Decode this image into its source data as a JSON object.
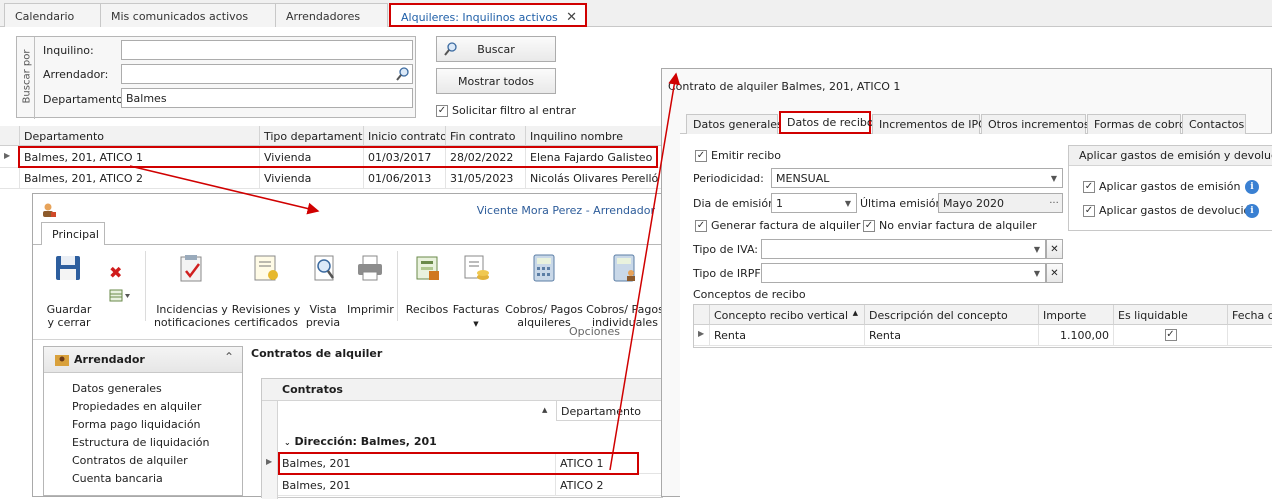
{
  "tabs": [
    {
      "label": "Calendario"
    },
    {
      "label": "Mis comunicados activos"
    },
    {
      "label": "Arrendadores"
    },
    {
      "label": "Alquileres: Inquilinos activos"
    }
  ],
  "filter": {
    "group_label": "Buscar por",
    "inquilino_label": "Inquilino:",
    "inquilino_value": "",
    "arrendador_label": "Arrendador:",
    "arrendador_value": "",
    "departamento_label": "Departamento:",
    "departamento_value": "Balmes",
    "search_button": "Buscar",
    "show_all_button": "Mostrar todos",
    "request_filter_label": "Solicitar filtro al entrar"
  },
  "main_grid": {
    "columns": [
      "Departamento",
      "Tipo departamento",
      "Inicio contrato",
      "Fin contrato",
      "Inquilino nombre"
    ],
    "rows": [
      [
        "Balmes, 201, ATICO 1",
        "Vivienda",
        "01/03/2017",
        "28/02/2022",
        "Elena Fajardo Galisteo"
      ],
      [
        "Balmes, 201, ATICO 2",
        "Vivienda",
        "01/06/2013",
        "31/05/2023",
        "Nicolás Olivares Perelló"
      ]
    ]
  },
  "landlord_window": {
    "title": "Vicente Mora Perez - Arrendador",
    "ribbon_tab": "Principal",
    "buttons": [
      {
        "label": "Guardar\ny cerrar",
        "icon": "save-icon"
      },
      {
        "label": "Incidencias y\nnotificaciones",
        "icon": "incidents-icon"
      },
      {
        "label": "Revisiones y\ncertificados",
        "icon": "certificate-icon"
      },
      {
        "label": "Vista\nprevia",
        "icon": "preview-icon"
      },
      {
        "label": "Imprimir",
        "icon": "print-icon"
      },
      {
        "label": "Recibos",
        "icon": "receipts-icon"
      },
      {
        "label": "Facturas",
        "icon": "invoices-icon"
      },
      {
        "label": "Cobros/ Pagos\nalquileres",
        "icon": "calculator-icon"
      },
      {
        "label": "Cobros/ Pagos\nindividuales",
        "icon": "calculator-person-icon"
      }
    ],
    "group_label": "Opciones",
    "nav_header": "Arrendador",
    "nav_items": [
      "Datos generales",
      "Propiedades en alquiler",
      "Forma pago liquidación",
      "Estructura de liquidación",
      "Contratos de alquiler",
      "Cuenta bancaria"
    ],
    "contracts_title": "Contratos de alquiler",
    "contracts_grid_title": "Contratos",
    "contracts_col": "Departamento",
    "group_row": "Dirección: Balmes, 201",
    "contracts_rows": [
      [
        "Balmes, 201",
        "ATICO 1"
      ],
      [
        "Balmes, 201",
        "ATICO 2"
      ]
    ]
  },
  "contract_window": {
    "title": "Contrato de alquiler Balmes, 201, ATICO 1",
    "tabs": [
      "Datos generales",
      "Datos de recibo",
      "Incrementos de IPC",
      "Otros incrementos",
      "Formas de cobro",
      "Contactos"
    ],
    "emitir_recibo": "Emitir recibo",
    "periodicidad_label": "Periodicidad:",
    "periodicidad_value": "MENSUAL",
    "dia_label": "Dia de emisión:",
    "dia_value": "1",
    "ultima_label": "Última emisión:",
    "ultima_value": "Mayo 2020",
    "generar_factura": "Generar factura de alquiler",
    "no_enviar": "No enviar factura de alquiler",
    "iva_label": "Tipo de IVA:",
    "irpf_label": "Tipo de IRPF:",
    "conceptos_label": "Conceptos de recibo",
    "side_group_title": "Aplicar gastos de emisión y devolucion",
    "aplicar_emision": "Aplicar gastos de emisión",
    "aplicar_devolucion": "Aplicar gastos de devolución",
    "concept_columns": [
      "Concepto recibo vertical",
      "Descripción del concepto",
      "Importe",
      "Es liquidable",
      "Fecha de"
    ],
    "concept_rows": [
      [
        "Renta",
        "Renta",
        "1.100,00"
      ]
    ]
  }
}
